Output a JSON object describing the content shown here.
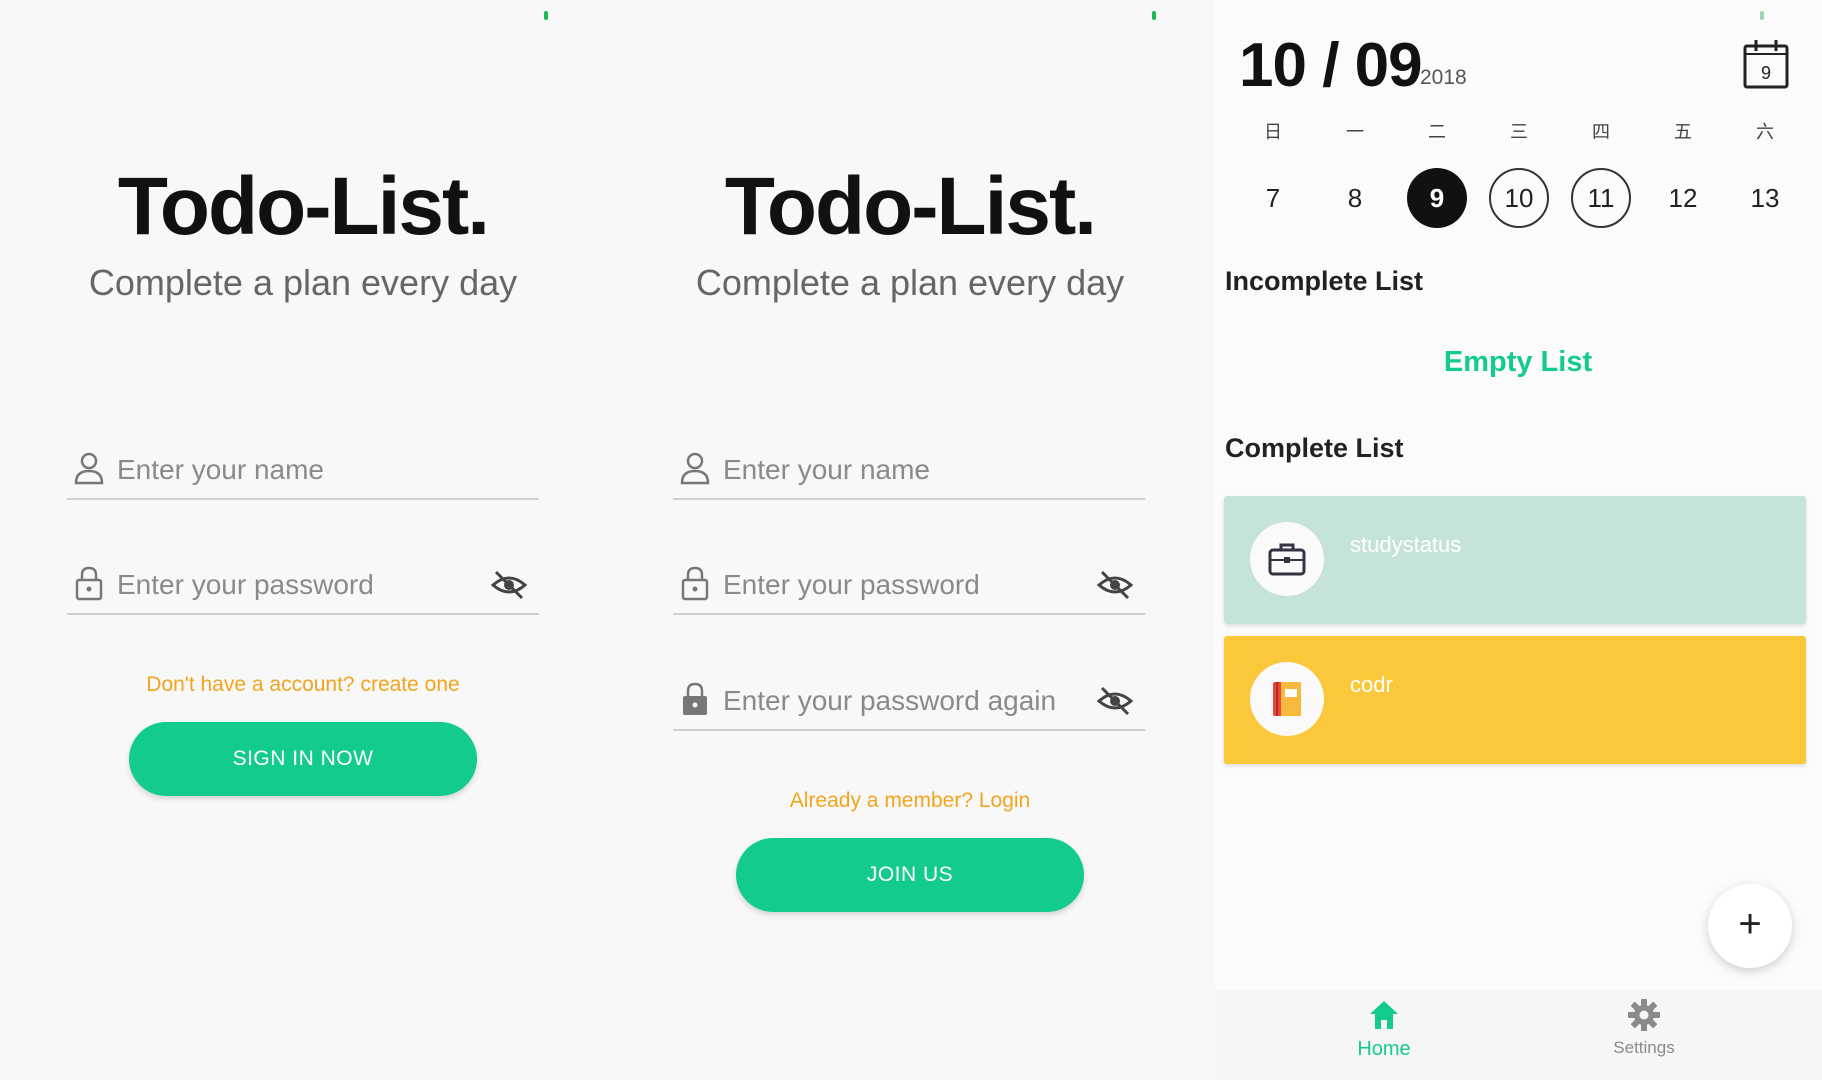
{
  "login": {
    "brand": "Todo-List.",
    "tagline": "Complete a plan every day",
    "name_placeholder": "Enter your name",
    "password_placeholder": "Enter your password",
    "link_text": "Don't have a account? create one",
    "button_label": "SIGN IN NOW"
  },
  "register": {
    "brand": "Todo-List.",
    "tagline": "Complete a plan every day",
    "name_placeholder": "Enter your name",
    "password_placeholder": "Enter your password",
    "password_again_placeholder": "Enter your password again",
    "link_text": "Already a member? Login",
    "button_label": "JOIN US"
  },
  "home": {
    "date": "10 / 09",
    "year": "2018",
    "calendar_icon_day": "9",
    "weekdays": [
      "日",
      "一",
      "二",
      "三",
      "四",
      "五",
      "六"
    ],
    "days": [
      "7",
      "8",
      "9",
      "10",
      "11",
      "12",
      "13"
    ],
    "incomplete_title": "Incomplete List",
    "empty_text": "Empty List",
    "complete_title": "Complete List",
    "tasks": [
      {
        "title": "studystatus",
        "icon": "briefcase-icon",
        "color": "#c5e3d8"
      },
      {
        "title": "codr",
        "icon": "book-icon",
        "color": "#fbc83c"
      }
    ],
    "fab_label": "+",
    "nav": {
      "home": "Home",
      "settings": "Settings"
    }
  },
  "colors": {
    "accent": "#13cc8c",
    "link": "#f2a51c",
    "text": "#222222"
  }
}
